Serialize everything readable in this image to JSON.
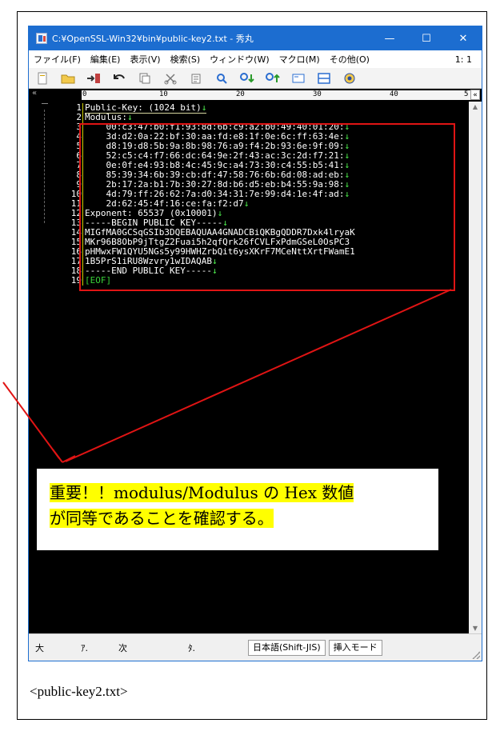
{
  "window": {
    "title": "C:¥OpenSSL-Win32¥bin¥public-key2.txt - 秀丸",
    "minimize": "—",
    "maximize": "☐",
    "close": "✕"
  },
  "menu": {
    "items": [
      "ファイル(F)",
      "編集(E)",
      "表示(V)",
      "検索(S)",
      "ウィンドウ(W)",
      "マクロ(M)",
      "その他(O)"
    ],
    "position": "1: 1"
  },
  "toolbar": {
    "icons": [
      "new-file-icon",
      "open-folder-icon",
      "save-icon",
      "undo-icon",
      "copy-icon",
      "cut-icon",
      "paste-icon",
      "search-icon",
      "search-down-icon",
      "search-up-icon",
      "window-icon",
      "split-icon",
      "help-icon"
    ]
  },
  "ruler": {
    "labels": [
      "0",
      "10",
      "20",
      "30",
      "40",
      "5"
    ],
    "button": "«"
  },
  "editor": {
    "lines": [
      {
        "n": "1",
        "t": "Public-Key: (1024 bit)",
        "eol": "↓"
      },
      {
        "n": "2",
        "t": "Modulus:",
        "eol": "↓"
      },
      {
        "n": "3",
        "t": "    00:c3:47:b0:f1:93:8d:6b:c9:a2:b0:49:40:01:20:",
        "eol": "↓"
      },
      {
        "n": "4",
        "t": "    3d:d2:0a:22:bf:30:aa:fd:e8:1f:0e:6c:ff:63:4e:",
        "eol": "↓"
      },
      {
        "n": "5",
        "t": "    d8:19:d8:5b:9a:8b:98:76:a9:f4:2b:93:6e:9f:09:",
        "eol": "↓"
      },
      {
        "n": "6",
        "t": "    52:c5:c4:f7:66:dc:64:9e:2f:43:ac:3c:2d:f7:21:",
        "eol": "↓"
      },
      {
        "n": "7",
        "t": "    0e:0f:e4:93:b8:4c:45:9c:a4:73:30:c4:55:b5:41:",
        "eol": "↓"
      },
      {
        "n": "8",
        "t": "    85:39:34:6b:39:cb:df:47:58:76:6b:6d:08:ad:eb:",
        "eol": "↓"
      },
      {
        "n": "9",
        "t": "    2b:17:2a:b1:7b:30:27:8d:b6:d5:eb:b4:55:9a:98:",
        "eol": "↓"
      },
      {
        "n": "10",
        "t": "    4d:79:ff:26:62:7a:d0:34:31:7e:99:d4:1e:4f:ad:",
        "eol": "↓"
      },
      {
        "n": "11",
        "t": "    2d:62:45:4f:16:ce:fa:f2:d7",
        "eol": "↓"
      },
      {
        "n": "12",
        "t": "Exponent: 65537 (0x10001)",
        "eol": "↓"
      },
      {
        "n": "13",
        "t": "-----BEGIN PUBLIC KEY-----",
        "eol": "↓"
      },
      {
        "n": "14",
        "t": "MIGfMA0GCSqGSIb3DQEBAQUAA4GNADCBiQKBgQDDR7Dxk4lryaK",
        "eol": ""
      },
      {
        "n": "15",
        "t": "MKr96B8ObP9jTtgZ2Fuai5h2qfQrk26fCVLFxPdmGSeL0OsPC3",
        "eol": ""
      },
      {
        "n": "16",
        "t": "pHMwxFW1QYU5NGs5y99HWHZrbQit6ysXKrF7MCeNttXrtFWamE1",
        "eol": ""
      },
      {
        "n": "17",
        "t": "1B5PrS1iRU8Wzvry1wIDAQAB",
        "eol": "↓"
      },
      {
        "n": "18",
        "t": "-----END PUBLIC KEY-----",
        "eol": "↓"
      },
      {
        "n": "19",
        "t": "[EOF]",
        "eol": ""
      }
    ]
  },
  "statusbar": {
    "items": [
      "大",
      "ｱ.",
      "次",
      "ﾀ."
    ],
    "encoding": "日本語(Shift-JIS)",
    "mode": "挿入モード"
  },
  "callout": {
    "line1": "重要！！modulus/Modulus の Hex 数値",
    "line2": "が同等であることを確認する。"
  },
  "caption": "<public-key2.txt>",
  "colors": {
    "titlebar": "#1c6dd0",
    "editor_bg": "#000000",
    "highlight": "#e01414",
    "marker": "#ffff00",
    "eol": "#4ff04f"
  }
}
